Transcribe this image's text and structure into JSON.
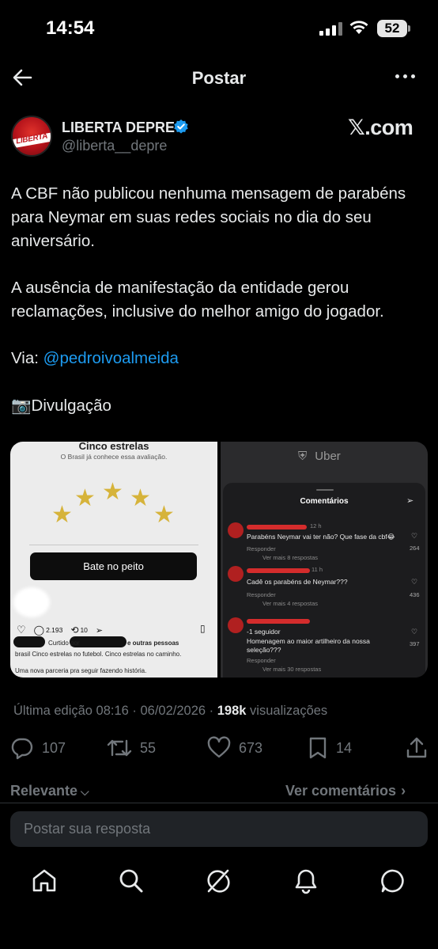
{
  "status_bar": {
    "time": "14:54",
    "battery": "52"
  },
  "header": {
    "title": "Postar"
  },
  "author": {
    "name": "LIBERTA DEPRE",
    "handle": "@liberta__depre",
    "avatar_text": "LIBERTA",
    "badge_color": "#1d9bf0"
  },
  "source_logo": "𝕏.com",
  "post": {
    "line1": "A CBF não publicou nenhuma mensagem de parabéns",
    "line2": "para Neymar em suas redes sociais no dia do seu",
    "line3": "aniversário.",
    "line4": "A ausência de manifestação da entidade gerou",
    "line5": "reclamações, inclusive do melhor amigo do jogador.",
    "via_label": "Via: ",
    "via_link": "@pedroivoalmeida",
    "credit": "📷Divulgação"
  },
  "media": {
    "left": {
      "title": "Cinco estrelas",
      "subtitle": "O Brasil já conhece essa avaliação.",
      "button": "Bate no peito",
      "comments": "2.193",
      "reposts": "10",
      "liked_by": "Curtido por",
      "liked_by_rest": "e outras pessoas",
      "caption1": "brasil Cinco estrelas no futebol. Cinco estrelas no caminho.",
      "caption2": "Uma nova parceria pra seguir fazendo história."
    },
    "right": {
      "brand": "Uber",
      "panel_title": "Comentários",
      "comments": [
        {
          "time": "12 h",
          "text": "Parabéns Neymar vai ter não? Que fase da cbf😂",
          "reply": "Responder",
          "more": "Ver mais 8 respostas",
          "likes": "264"
        },
        {
          "time": "11 h",
          "text": "Cadê os parabéns de Neymar???",
          "reply": "Responder",
          "more": "Ver mais 4 respostas",
          "likes": "436"
        },
        {
          "time": "",
          "text_a": "-1 seguidor",
          "text_b": "Homenagem ao maior artilheiro da nossa",
          "text_c": "seleção???",
          "reply": "Responder",
          "more": "Ver mais 30 respostas",
          "likes": "397"
        }
      ]
    }
  },
  "meta": {
    "edited": "Última edição 08:16 · 06/02/2026",
    "sep": " · ",
    "views": "198k",
    "views_label": " visualizações"
  },
  "actions": {
    "replies": "107",
    "reposts": "55",
    "likes": "673",
    "bookmarks": "14"
  },
  "sort": {
    "label": "Relevante",
    "view_comments": "Ver comentários"
  },
  "reply_placeholder": "Postar sua resposta"
}
